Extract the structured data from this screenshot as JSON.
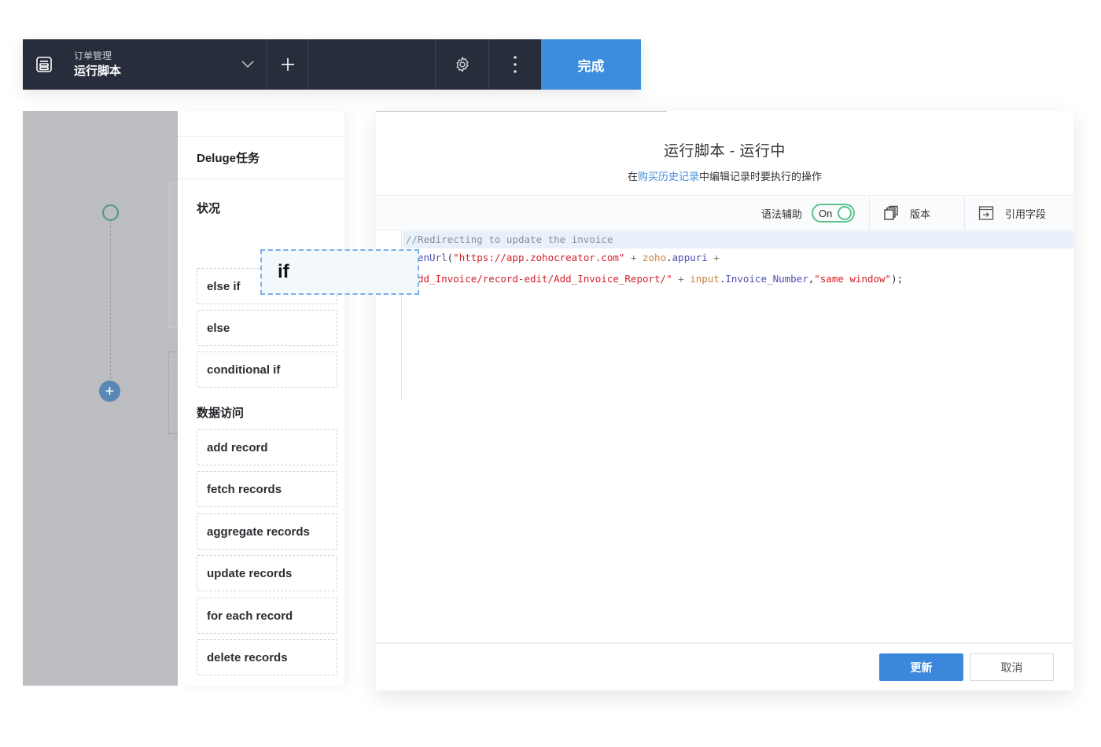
{
  "topbar": {
    "app_icon": "form-icon",
    "breadcrumb_parent": "订单管理",
    "title": "运行脚本",
    "dropdown_icon": "chevron-down-icon",
    "add_icon": "plus-icon",
    "settings_icon": "gear-icon",
    "more_icon": "more-vertical-icon",
    "done_label": "完成",
    "colors": {
      "bar": "#272d3b",
      "done": "#3b8ddd"
    }
  },
  "canvas": {
    "start_node_icon": "circle-node-icon",
    "add_node_icon": "plus-circle-icon",
    "add_node_glyph": "+"
  },
  "panel": {
    "section_deluge": "Deluge任务",
    "section_status": "状况",
    "condition_tasks": [
      {
        "label": "else if"
      },
      {
        "label": "else"
      },
      {
        "label": "conditional if"
      }
    ],
    "section_data_access": "数据访问",
    "data_tasks": [
      {
        "label": "add record"
      },
      {
        "label": "fetch records"
      },
      {
        "label": "aggregate records"
      },
      {
        "label": "update records"
      },
      {
        "label": "for each record"
      },
      {
        "label": "delete records"
      }
    ],
    "dragging_task": {
      "label": "if"
    }
  },
  "dialog": {
    "title": "运行脚本 - 运行中",
    "desc_prefix": "在",
    "desc_link": "购买历史记录",
    "desc_suffix": "中编辑记录时要执行的操作",
    "toolbar": {
      "syntax_assist_label": "语法辅助",
      "syntax_toggle_state": "On",
      "version_label": "版本",
      "version_icon": "copy-stack-icon",
      "reference_fields_label": "引用字段",
      "reference_fields_icon": "insert-field-icon"
    },
    "code": {
      "line1_comment": "//Redirecting to update the invoice",
      "line2": {
        "fn": "enUrl",
        "open": "(",
        "str1": "\"https://app.zohocreator.com\"",
        "plus1": " + ",
        "var1": "zoho",
        "dot1": ".",
        "prop1": "appuri",
        "plus2": " +"
      },
      "line3": {
        "str2": "dd_Invoice/record-edit/Add_Invoice_Report/\"",
        "plus3": " + ",
        "var2": "input",
        "dot2": ".",
        "prop2": "Invoice_Number",
        "comma": ",",
        "str3": "\"same window\"",
        "close": ");"
      }
    },
    "footer": {
      "update_label": "更新",
      "cancel_label": "取消"
    },
    "colors": {
      "link": "#3f8ee0",
      "primary": "#3b87dc",
      "toggle": "#5cc28e"
    }
  }
}
